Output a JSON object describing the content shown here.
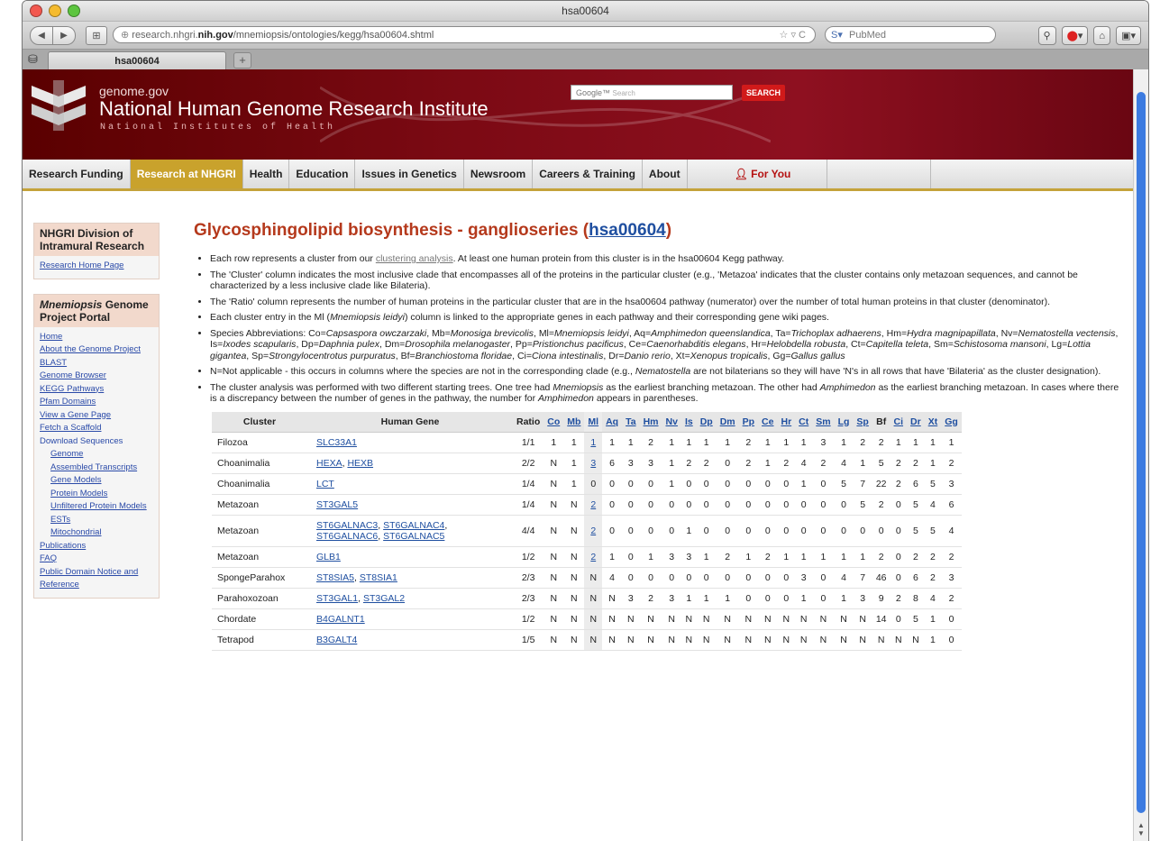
{
  "window": {
    "title": "hsa00604"
  },
  "toolbar": {
    "url_host_prefix": "research.nhgri.",
    "url_host_bold": "nih.gov",
    "url_path": "/mnemiopsis/ontologies/kegg/hsa00604.shtml",
    "search_placeholder": "PubMed"
  },
  "tab": {
    "label": "hsa00604",
    "new_tab": "+"
  },
  "banner": {
    "site": "genome.gov",
    "institute": "National Human Genome Research Institute",
    "nih": "National Institutes of Health",
    "search_placeholder": "Search",
    "search_button": "SEARCH"
  },
  "nav": {
    "items": [
      "Research Funding",
      "Research at NHGRI",
      "Health",
      "Education",
      "Issues in Genetics",
      "Newsroom",
      "Careers & Training",
      "About"
    ],
    "active": "Research at NHGRI",
    "for_you": "For You"
  },
  "sidebar": {
    "box1_title": "NHGRI Division of Intramural Research",
    "box1_links": [
      "Research Home Page"
    ],
    "box2_title_em": "Mnemiopsis",
    "box2_title_rest": " Genome Project Portal",
    "box2_links": [
      {
        "label": "Home",
        "sub": false
      },
      {
        "label": "About the Genome Project",
        "sub": false
      },
      {
        "label": "BLAST",
        "sub": false
      },
      {
        "label": "Genome Browser",
        "sub": false
      },
      {
        "label": "KEGG Pathways",
        "sub": false
      },
      {
        "label": "Pfam Domains",
        "sub": false
      },
      {
        "label": "View a Gene Page",
        "sub": false
      },
      {
        "label": "Fetch a Scaffold",
        "sub": false
      },
      {
        "label": "Download Sequences",
        "sub": false,
        "plain": true
      },
      {
        "label": "Genome",
        "sub": true
      },
      {
        "label": "Assembled Transcripts",
        "sub": true
      },
      {
        "label": "Gene Models",
        "sub": true
      },
      {
        "label": "Protein Models",
        "sub": true
      },
      {
        "label": "Unfiltered Protein Models",
        "sub": true
      },
      {
        "label": "ESTs",
        "sub": true
      },
      {
        "label": "Mitochondrial",
        "sub": true
      },
      {
        "label": "Publications",
        "sub": false
      },
      {
        "label": "FAQ",
        "sub": false
      },
      {
        "label": "Public Domain Notice and Reference",
        "sub": false
      }
    ]
  },
  "main": {
    "title": "Glycosphingolipid biosynthesis - ganglioseries (",
    "title_code": "hsa00604",
    "title_close": ")",
    "notes": {
      "n1_a": "Each row represents a cluster from our ",
      "n1_link": "clustering analysis",
      "n1_b": ". At least one human protein from this cluster is in the hsa00604 Kegg pathway.",
      "n2": "The 'Cluster' column indicates the most inclusive clade that encompasses all of the proteins in the particular cluster (e.g., 'Metazoa' indicates that the cluster contains only metazoan sequences, and cannot be characterized by a less inclusive clade like Bilateria).",
      "n3": "The 'Ratio' column represents the number of human proteins in the particular cluster that are in the hsa00604 pathway (numerator) over the number of total human proteins in that cluster (denominator).",
      "n4_a": "Each cluster entry in the Ml (",
      "n4_em": "Mnemiopsis leidyi",
      "n4_b": ") column is linked to the appropriate genes in each pathway and their corresponding gene wiki pages.",
      "n6_a": "N=Not applicable - this occurs in columns where the species are not in the corresponding clade (e.g., ",
      "n6_em": "Nematostella",
      "n6_b": " are not bilaterians so they will have 'N's in all rows that have 'Bilateria' as the cluster designation).",
      "n7_a": "The cluster analysis was performed with two different starting trees. One tree had ",
      "n7_em1": "Mnemiopsis",
      "n7_b": " as the earliest branching metazoan. The other had ",
      "n7_em2": "Amphimedon",
      "n7_c": " as the earliest branching metazoan. In cases where there is a discrepancy between the number of genes in the pathway, the number for ",
      "n7_em3": "Amphimedon",
      "n7_d": " appears in parentheses."
    },
    "species_lead": "Species Abbreviations: ",
    "species": [
      [
        "Co",
        "Capsaspora owczarzaki"
      ],
      [
        "Mb",
        "Monosiga brevicolis"
      ],
      [
        "Ml",
        "Mnemiopsis leidyi"
      ],
      [
        "Aq",
        "Amphimedon queenslandica"
      ],
      [
        "Ta",
        "Trichoplax adhaerens"
      ],
      [
        "Hm",
        "Hydra magnipapillata"
      ],
      [
        "Nv",
        "Nematostella vectensis"
      ],
      [
        "Is",
        "Ixodes scapularis"
      ],
      [
        "Dp",
        "Daphnia pulex"
      ],
      [
        "Dm",
        "Drosophila melanogaster"
      ],
      [
        "Pp",
        "Pristionchus pacificus"
      ],
      [
        "Ce",
        "Caenorhabditis elegans"
      ],
      [
        "Hr",
        "Helobdella robusta"
      ],
      [
        "Ct",
        "Capitella teleta"
      ],
      [
        "Sm",
        "Schistosoma mansoni"
      ],
      [
        "Lg",
        "Lottia gigantea"
      ],
      [
        "Sp",
        "Strongylocentrotus purpuratus"
      ],
      [
        "Bf",
        "Branchiostoma floridae"
      ],
      [
        "Ci",
        "Ciona intestinalis"
      ],
      [
        "Dr",
        "Danio rerio"
      ],
      [
        "Xt",
        "Xenopus tropicalis"
      ],
      [
        "Gg",
        "Gallus gallus"
      ]
    ]
  },
  "table": {
    "headers": {
      "cluster": "Cluster",
      "gene": "Human Gene",
      "ratio": "Ratio"
    },
    "species_cols": [
      "Co",
      "Mb",
      "Ml",
      "Aq",
      "Ta",
      "Hm",
      "Nv",
      "Is",
      "Dp",
      "Dm",
      "Pp",
      "Ce",
      "Hr",
      "Ct",
      "Sm",
      "Lg",
      "Sp",
      "Bf",
      "Ci",
      "Dr",
      "Xt",
      "Gg"
    ],
    "rows": [
      {
        "cluster": "Filozoa",
        "genes": [
          "SLC33A1"
        ],
        "ratio": "1/1",
        "vals": [
          "1",
          "1",
          "1",
          "1",
          "1",
          "2",
          "1",
          "1",
          "1",
          "1",
          "2",
          "1",
          "1",
          "1",
          "3",
          "1",
          "2",
          "2",
          "1",
          "1",
          "1",
          "1"
        ]
      },
      {
        "cluster": "Choanimalia",
        "genes": [
          "HEXA",
          "HEXB"
        ],
        "ratio": "2/2",
        "vals": [
          "N",
          "1",
          "3",
          "6",
          "3",
          "3",
          "1",
          "2",
          "2",
          "0",
          "2",
          "1",
          "2",
          "4",
          "2",
          "4",
          "1",
          "5",
          "2",
          "2",
          "1",
          "2"
        ]
      },
      {
        "cluster": "Choanimalia",
        "genes": [
          "LCT"
        ],
        "ratio": "1/4",
        "vals": [
          "N",
          "1",
          "0",
          "0",
          "0",
          "0",
          "1",
          "0",
          "0",
          "0",
          "0",
          "0",
          "0",
          "1",
          "0",
          "5",
          "7",
          "22",
          "2",
          "6",
          "5",
          "3"
        ]
      },
      {
        "cluster": "Metazoan",
        "genes": [
          "ST3GAL5"
        ],
        "ratio": "1/4",
        "vals": [
          "N",
          "N",
          "2",
          "0",
          "0",
          "0",
          "0",
          "0",
          "0",
          "0",
          "0",
          "0",
          "0",
          "0",
          "0",
          "0",
          "5",
          "2",
          "0",
          "5",
          "4",
          "6"
        ]
      },
      {
        "cluster": "Metazoan",
        "genes": [
          "ST6GALNAC3",
          "ST6GALNAC4",
          "ST6GALNAC6",
          "ST6GALNAC5"
        ],
        "ratio": "4/4",
        "vals": [
          "N",
          "N",
          "2",
          "0",
          "0",
          "0",
          "0",
          "1",
          "0",
          "0",
          "0",
          "0",
          "0",
          "0",
          "0",
          "0",
          "0",
          "0",
          "0",
          "5",
          "5",
          "4"
        ]
      },
      {
        "cluster": "Metazoan",
        "genes": [
          "GLB1"
        ],
        "ratio": "1/2",
        "vals": [
          "N",
          "N",
          "2",
          "1",
          "0",
          "1",
          "3",
          "3",
          "1",
          "2",
          "1",
          "2",
          "1",
          "1",
          "1",
          "1",
          "1",
          "2",
          "0",
          "2",
          "2",
          "2"
        ]
      },
      {
        "cluster": "SpongeParahox",
        "genes": [
          "ST8SIA5",
          "ST8SIA1"
        ],
        "ratio": "2/3",
        "vals": [
          "N",
          "N",
          "N",
          "4",
          "0",
          "0",
          "0",
          "0",
          "0",
          "0",
          "0",
          "0",
          "0",
          "3",
          "0",
          "4",
          "7",
          "46",
          "0",
          "6",
          "2",
          "3"
        ]
      },
      {
        "cluster": "Parahoxozoan",
        "genes": [
          "ST3GAL1",
          "ST3GAL2"
        ],
        "ratio": "2/3",
        "vals": [
          "N",
          "N",
          "N",
          "N",
          "3",
          "2",
          "3",
          "1",
          "1",
          "1",
          "0",
          "0",
          "0",
          "1",
          "0",
          "1",
          "3",
          "9",
          "2",
          "8",
          "4",
          "2"
        ]
      },
      {
        "cluster": "Chordate",
        "genes": [
          "B4GALNT1"
        ],
        "ratio": "1/2",
        "vals": [
          "N",
          "N",
          "N",
          "N",
          "N",
          "N",
          "N",
          "N",
          "N",
          "N",
          "N",
          "N",
          "N",
          "N",
          "N",
          "N",
          "N",
          "14",
          "0",
          "5",
          "1",
          "0"
        ]
      },
      {
        "cluster": "Tetrapod",
        "genes": [
          "B3GALT4"
        ],
        "ratio": "1/5",
        "vals": [
          "N",
          "N",
          "N",
          "N",
          "N",
          "N",
          "N",
          "N",
          "N",
          "N",
          "N",
          "N",
          "N",
          "N",
          "N",
          "N",
          "N",
          "N",
          "N",
          "N",
          "1",
          "0"
        ]
      }
    ]
  }
}
